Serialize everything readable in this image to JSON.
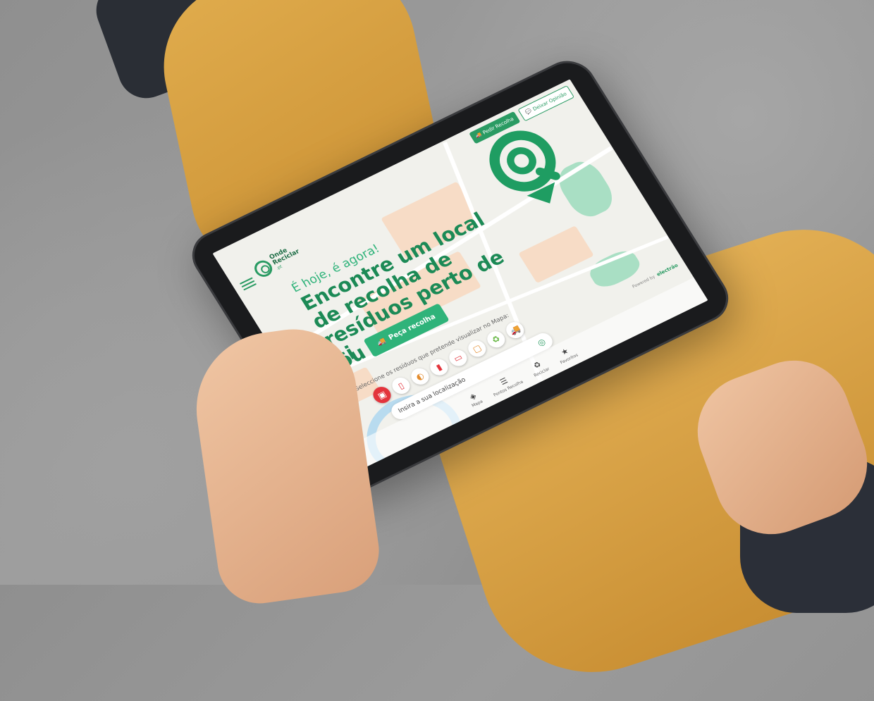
{
  "header": {
    "logo_line1": "Onde",
    "logo_line2": "Reciclar",
    "logo_suffix": ".pt",
    "btn_recolha": "Pedir Recolha",
    "btn_opiniao": "Deixar Opinião"
  },
  "hero": {
    "tagline": "É hoje, é agora!",
    "headline": "Encontre um local de recolha de resíduos perto de si",
    "ou": "ou",
    "cta": "Peça recolha"
  },
  "selector": {
    "label": "Seleccione os resíduos que pretende visualizar no Mapa:",
    "location_placeholder": "Insira a sua localização"
  },
  "powered": {
    "label": "Powered by",
    "brand": "electrão"
  },
  "nav": {
    "items": [
      "Mapa",
      "Pontos Recolha",
      "Reciclar",
      "Favoritos"
    ]
  },
  "colors": {
    "brand_green": "#2a9b63",
    "active_red": "#e3343c"
  }
}
